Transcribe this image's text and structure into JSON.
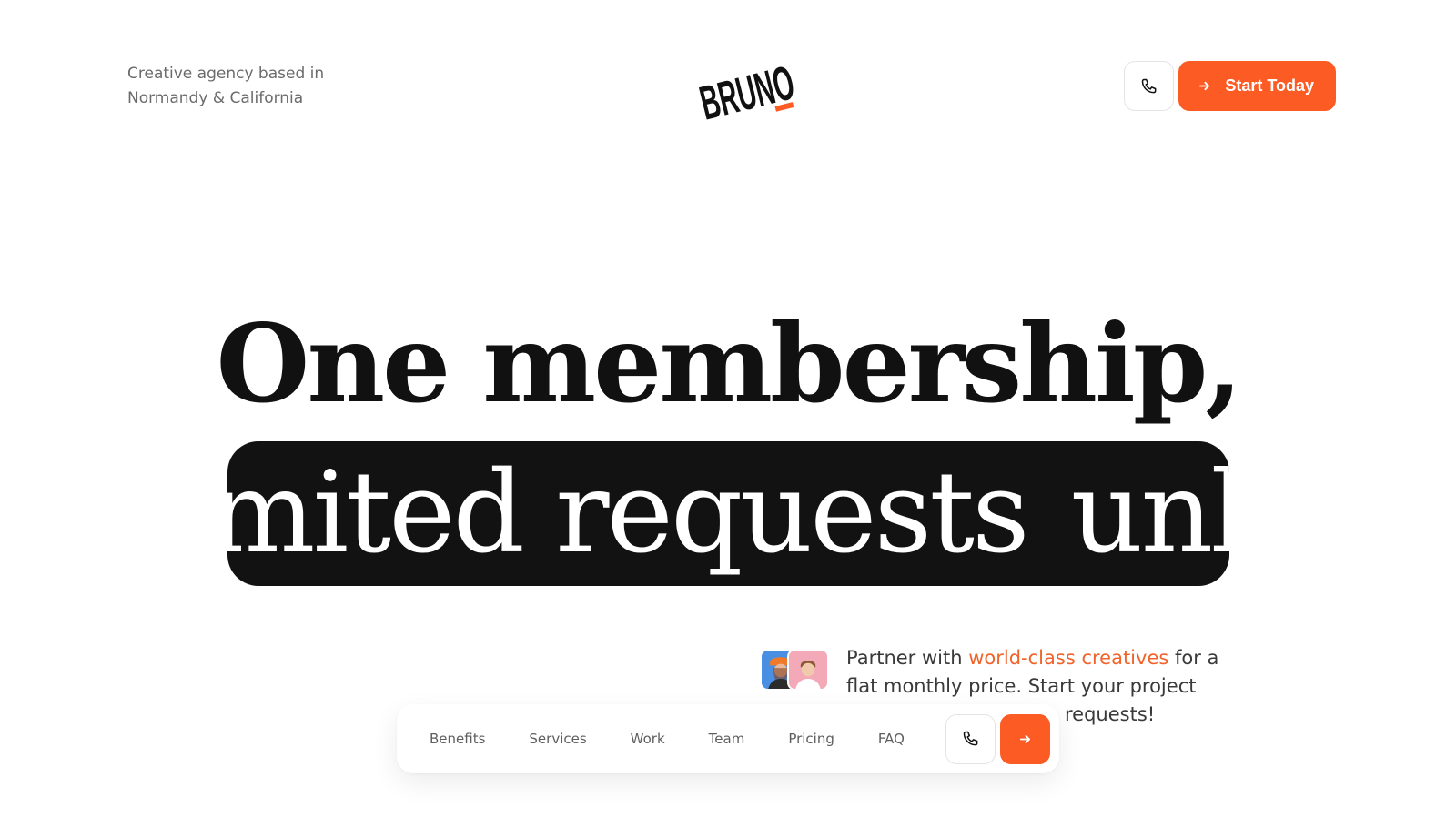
{
  "header": {
    "tagline_line1": "Creative agency based in",
    "tagline_line2": "Normandy & California",
    "logo_text": "BRUNO",
    "phone_icon": "phone-icon",
    "cta_label": "Start Today",
    "cta_icon": "arrow-right-icon"
  },
  "hero": {
    "line1": "One membership,",
    "marquee_text": "unlimited requests"
  },
  "partner": {
    "text_before": "Partner with ",
    "text_accent": "world-class creatives",
    "text_after": " for a flat monthly price. Start your project",
    "text_line3": "requests!"
  },
  "floating_nav": {
    "links": [
      "Benefits",
      "Services",
      "Work",
      "Team",
      "Pricing",
      "FAQ"
    ],
    "phone_icon": "phone-icon",
    "go_icon": "arrow-right-icon"
  },
  "colors": {
    "accent": "#fc5b23",
    "accent_text": "#f0642b",
    "dark": "#121212",
    "muted_text": "#6b6b6b"
  }
}
